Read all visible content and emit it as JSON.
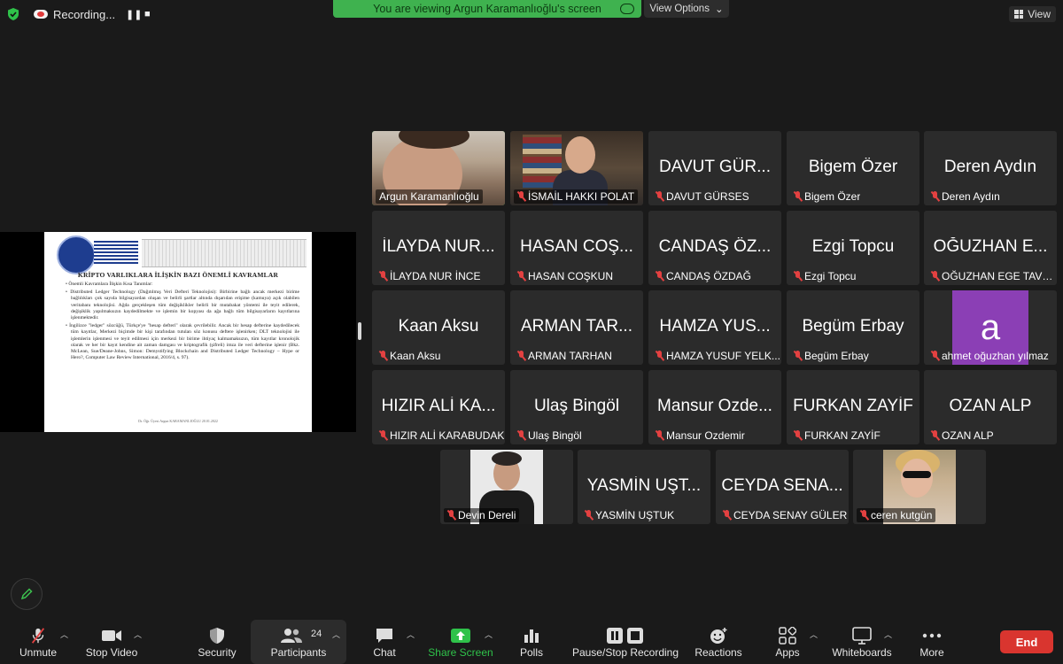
{
  "top": {
    "recording_label": "Recording...",
    "viewing_banner": "You are viewing Argun Karamanlıoğlu's screen",
    "view_options": "View Options",
    "view": "View"
  },
  "slide": {
    "title": "KRİPTO VARLIKLARA İLİŞKİN BAZI ÖNEMLİ KAVRAMLAR",
    "bullets": [
      "• Önemli Kavramlara İlişkin Kısa Tanımlar:",
      "• Distributed Ledger Technology (Dağıtılmış Veri Defteri Teknolojisi): Birbirine bağlı ancak merkezi birime bağlılıkları çok sayıda bilgisayardan oluşan ve belirli şartlar altında dışarıdan erişime (kamuya) açık olabilen veritabanı teknolojisi. Ağda gerçekleşen tüm değişiklikler belirli bir mutabakat yöntemi ile teyit edilerek, değişiklik yapılmaksızın kaydedilmekte ve işlemin bir kopyası da ağa bağlı tüm bilgisayarların kayıtlarına işlenmektedir.",
      "• İngilizce \"ledger\" sözcüğü, Türkçe'ye \"hesap defteri\" olarak çevrilebilir. Ancak bir hesap defterine kaydedilecek tüm kayıtlar, Merkezi biçimde bir kişi tarafından tutulan söz konusu deftere işlenirken; DLT teknolojisi ile işlemlerin işlenmesi ve teyit edilmesi için merkezi bir birime ihtiyaç kalmamaksızın, tüm kayıtlar kronolojik olarak ve her bir kayıt kendine ait zaman damgası ve kriptografik (şifreli) imza ile veri defterine işlenir (Bkz. McLean, Sue/Deane-Johns, Simon: Demystifying Blockchain and Distributed Ledger Technology – Hype or Hero?, Computer Law Review International, 2016/4, s. 97)."
    ],
    "footer": "Dr. Öğr. Üyesi Argun KARAMANLIOĞLU 20.01.2022"
  },
  "participants": [
    {
      "big": "",
      "name": "Argun Karamanlıoğlu",
      "muted": false,
      "video": "argun"
    },
    {
      "big": "",
      "name": "İSMAİL HAKKI POLAT",
      "muted": true,
      "video": "ismail"
    },
    {
      "big": "DAVUT GÜR...",
      "name": "DAVUT GÜRSES",
      "muted": true
    },
    {
      "big": "Bigem Özer",
      "name": "Bigem Özer",
      "muted": true
    },
    {
      "big": "Deren Aydın",
      "name": "Deren Aydın",
      "muted": true
    },
    {
      "big": "İLAYDA NUR...",
      "name": "İLAYDA NUR İNCE",
      "muted": true
    },
    {
      "big": "HASAN COŞ...",
      "name": "HASAN COŞKUN",
      "muted": true
    },
    {
      "big": "CANDAŞ ÖZ...",
      "name": "CANDAŞ ÖZDAĞ",
      "muted": true
    },
    {
      "big": "Ezgi Topcu",
      "name": "Ezgi Topcu",
      "muted": true
    },
    {
      "big": "OĞUZHAN E...",
      "name": "OĞUZHAN EGE TAVU...",
      "muted": true
    },
    {
      "big": "Kaan Aksu",
      "name": "Kaan Aksu",
      "muted": true
    },
    {
      "big": "ARMAN TAR...",
      "name": "ARMAN TARHAN",
      "muted": true
    },
    {
      "big": "HAMZA YUS...",
      "name": "HAMZA YUSUF YELK...",
      "muted": true
    },
    {
      "big": "Begüm Erbay",
      "name": "Begüm Erbay",
      "muted": true
    },
    {
      "big": "a",
      "name": "ahmet oğuzhan yılmaz",
      "muted": true,
      "avatar": true
    },
    {
      "big": "HIZIR ALİ KA...",
      "name": "HIZIR ALİ KARABUDAK",
      "muted": true
    },
    {
      "big": "Ulaş Bingöl",
      "name": "Ulaş Bingöl",
      "muted": true
    },
    {
      "big": "Mansur Ozde...",
      "name": "Mansur Ozdemir",
      "muted": true
    },
    {
      "big": "FURKAN ZAYİF",
      "name": "FURKAN ZAYİF",
      "muted": true
    },
    {
      "big": "OZAN ALP",
      "name": "OZAN ALP",
      "muted": true
    },
    {
      "big": "",
      "name": "Devin Dereli",
      "muted": true,
      "video": "devin"
    },
    {
      "big": "YASMİN UŞT...",
      "name": "YASMİN UŞTUK",
      "muted": true
    },
    {
      "big": "CEYDA SENA...",
      "name": "CEYDA SENAY GÜLER",
      "muted": true
    },
    {
      "big": "",
      "name": "ceren kutgün",
      "muted": true,
      "video": "ceren"
    }
  ],
  "toolbar": {
    "unmute": "Unmute",
    "stop_video": "Stop Video",
    "security": "Security",
    "participants": "Participants",
    "participant_count": "24",
    "chat": "Chat",
    "share_screen": "Share Screen",
    "polls": "Polls",
    "pause_stop_recording": "Pause/Stop Recording",
    "reactions": "Reactions",
    "apps": "Apps",
    "whiteboards": "Whiteboards",
    "more": "More",
    "end": "End"
  },
  "colors": {
    "banner_green": "#3fb24f",
    "share_green": "#2fc24a",
    "end_red": "#d9352f",
    "muted_red": "#e34141",
    "avatar_purple": "#8b3fb5"
  }
}
